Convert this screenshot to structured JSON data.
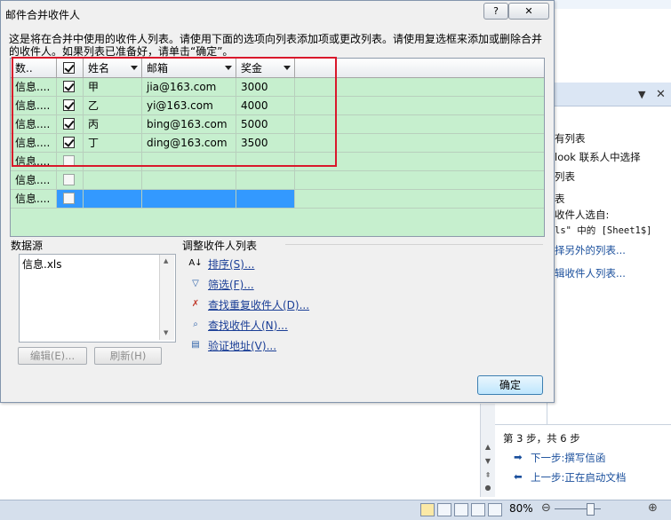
{
  "dialog": {
    "title": "邮件合并收件人",
    "help_label": "?",
    "close_label": "✕",
    "intro": "这是将在合并中使用的收件人列表。请使用下面的选项向列表添加项或更改列表。请使用复选框来添加或删除合并的收件人。如果列表已准备好，请单击“确定”。",
    "ok_label": "确定"
  },
  "table": {
    "headers": [
      "数..",
      "",
      "姓名",
      "邮箱",
      "奖金"
    ],
    "rows": [
      {
        "source": "信息....",
        "checked": true,
        "name": "甲",
        "email": "jia@163.com",
        "bonus": "3000"
      },
      {
        "source": "信息....",
        "checked": true,
        "name": "乙",
        "email": "yi@163.com",
        "bonus": "4000"
      },
      {
        "source": "信息....",
        "checked": true,
        "name": "丙",
        "email": "bing@163.com",
        "bonus": "5000"
      },
      {
        "source": "信息....",
        "checked": true,
        "name": "丁",
        "email": "ding@163.com",
        "bonus": "3500"
      },
      {
        "source": "信息....",
        "checked": false,
        "name": "",
        "email": "",
        "bonus": ""
      },
      {
        "source": "信息....",
        "checked": false,
        "name": "",
        "email": "",
        "bonus": ""
      },
      {
        "source": "信息....",
        "checked": false,
        "name": "",
        "email": "",
        "bonus": ""
      }
    ],
    "selected_row": 6
  },
  "datasource": {
    "label": "数据源",
    "file": "信息.xls",
    "edit_label": "编辑(E)...",
    "refresh_label": "刷新(H)"
  },
  "adjust": {
    "label": "调整收件人列表",
    "actions": [
      {
        "label": "排序(S)...",
        "icon": "sort-icon"
      },
      {
        "label": "筛选(F)...",
        "icon": "filter-icon"
      },
      {
        "label": "查找重复收件人(D)...",
        "icon": "find-duplicates-icon"
      },
      {
        "label": "查找收件人(N)...",
        "icon": "find-recipient-icon"
      },
      {
        "label": "验证地址(V)...",
        "icon": "validate-address-icon"
      }
    ]
  },
  "pane": {
    "lines": [
      "有列表",
      "look 联系人中选择",
      "列表",
      "表",
      "收件人选自:",
      "ls\" 中的 [Sheet1$]"
    ],
    "links": [
      "择另外的列表...",
      "辑收件人列表..."
    ],
    "step": "第 3 步，共 6 步",
    "next": "下一步:撰写信函",
    "prev": "上一步:正在启动文档"
  },
  "status": {
    "zoom": "80%"
  },
  "colors": {
    "grid_bg": "#c6efce",
    "selection": "#3399ff",
    "highlight": "#d9182b",
    "link": "#1a3e96"
  }
}
